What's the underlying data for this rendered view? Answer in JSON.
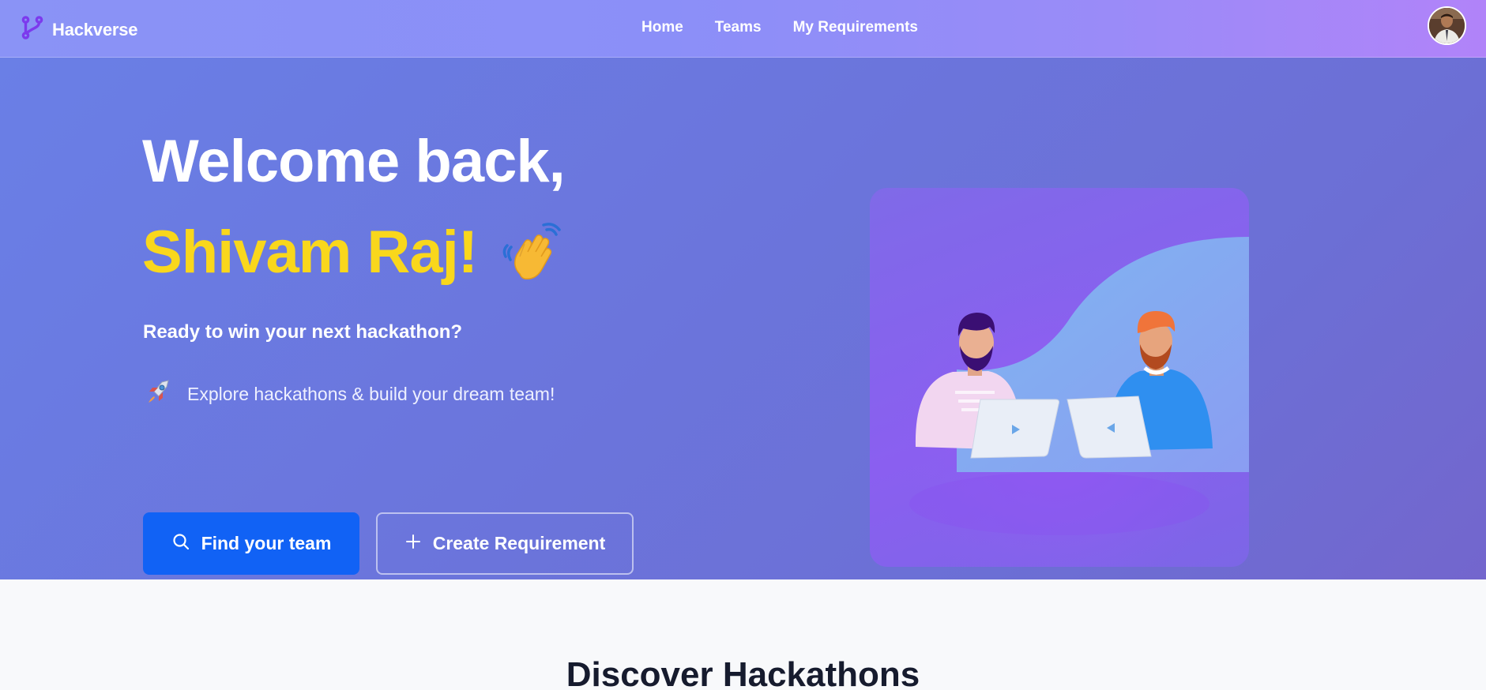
{
  "app": {
    "brand": "Hackverse"
  },
  "nav": {
    "links": [
      {
        "label": "Home"
      },
      {
        "label": "Teams"
      },
      {
        "label": "My Requirements"
      }
    ]
  },
  "hero": {
    "greeting": "Welcome back,",
    "user_name": "Shivam Raj!",
    "subtitle": "Ready to win your next hackathon?",
    "explore_text": "Explore hackathons & build your dream team!",
    "buttons": {
      "find_team": "Find your team",
      "create_requirement": "Create Requirement"
    }
  },
  "sections": {
    "discover_title": "Discover Hackathons"
  },
  "icons": {
    "brand": "git-branch-icon",
    "wave": "waving-hand-icon",
    "rocket": "rocket-icon",
    "search": "search-icon",
    "plus": "plus-icon"
  },
  "colors": {
    "accent_yellow": "#f9d71c",
    "primary_button": "#1162f5",
    "hero_bg": "#6b75dc",
    "nav_bg_start": "#8a93f6",
    "nav_bg_end": "#b183f9"
  }
}
